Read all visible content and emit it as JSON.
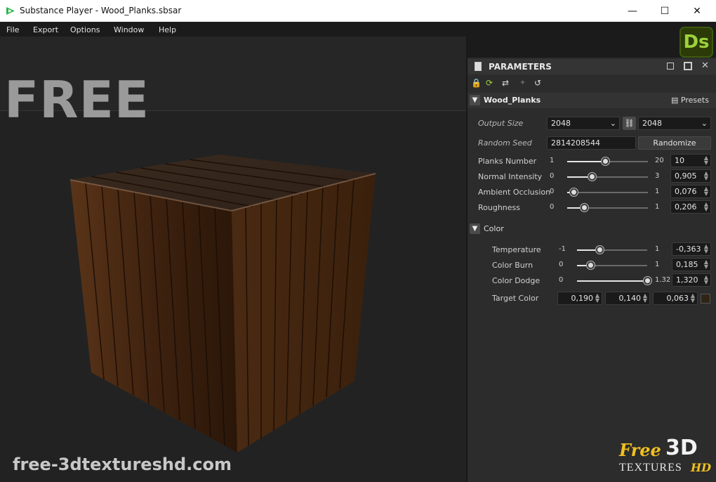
{
  "window": {
    "title": "Substance Player - Wood_Planks.sbsar",
    "minimize": "—",
    "maximize": "☐",
    "close": "✕"
  },
  "menu": [
    "File",
    "Export",
    "Options",
    "Window",
    "Help"
  ],
  "watermark": {
    "free": "FREE",
    "site": "free-3dtextureshd.com",
    "logo_free": "Free",
    "logo_3d": "3D",
    "logo_textures": "TEXTURES",
    "logo_hd": "HD"
  },
  "ds_badge": "Ds",
  "panel": {
    "title": "PARAMETERS",
    "graph_name": "Wood_Planks",
    "presets": "Presets"
  },
  "output_size": {
    "label": "Output Size",
    "width": "2048",
    "height": "2048"
  },
  "random_seed": {
    "label": "Random Seed",
    "value": "2814208544",
    "button": "Randomize"
  },
  "sliders": [
    {
      "label": "Planks Number",
      "min": "1",
      "max": "20",
      "value": "10",
      "frac": 0.47
    },
    {
      "label": "Normal Intensity",
      "min": "0",
      "max": "3",
      "value": "0,905",
      "frac": 0.3
    },
    {
      "label": "Ambient Occlusion",
      "min": "0",
      "max": "1",
      "value": "0,076",
      "frac": 0.08
    },
    {
      "label": "Roughness",
      "min": "0",
      "max": "1",
      "value": "0,206",
      "frac": 0.21
    }
  ],
  "color_section": {
    "title": "Color"
  },
  "color_sliders": [
    {
      "label": "Temperature",
      "min": "-1",
      "max": "1",
      "value": "-0,363",
      "frac": 0.32
    },
    {
      "label": "Color Burn",
      "min": "0",
      "max": "1",
      "value": "0,185",
      "frac": 0.19
    },
    {
      "label": "Color Dodge",
      "min": "0",
      "max": "1.32",
      "value": "1,320",
      "frac": 1.0
    }
  ],
  "target_color": {
    "label": "Target Color",
    "r": "0,190",
    "g": "0,140",
    "b": "0,063",
    "swatch": "#302414"
  },
  "colors": {
    "accent_green": "#9bd23a",
    "panel_bg": "#2c2c2c"
  }
}
